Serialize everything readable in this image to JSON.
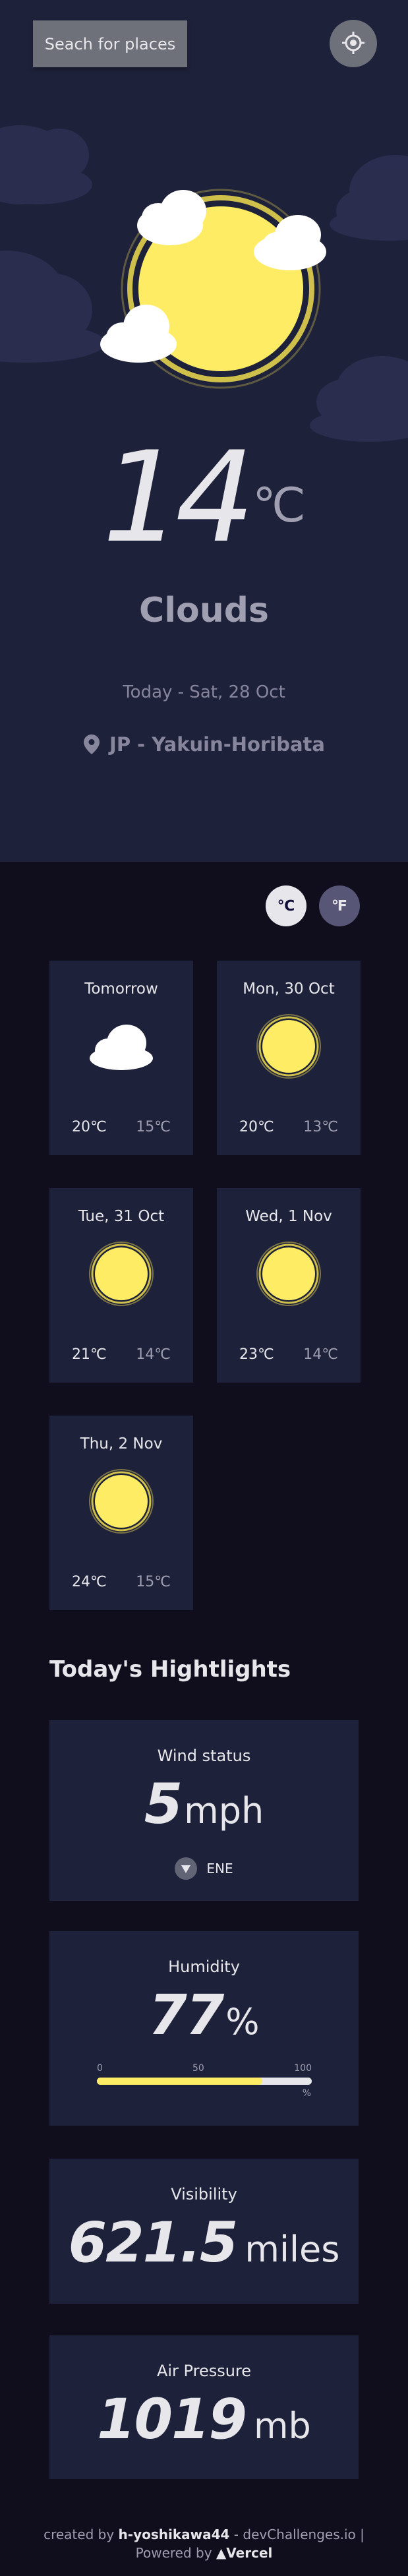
{
  "header": {
    "search_label": "Seach for places"
  },
  "current": {
    "temperature": "14",
    "unit": "℃",
    "condition": "Clouds",
    "date": "Today - Sat, 28 Oct",
    "location": "JP - Yakuin-Horibata"
  },
  "units": {
    "celsius": "℃",
    "fahrenheit": "℉",
    "selected": "celsius"
  },
  "forecast": [
    {
      "day": "Tomorrow",
      "icon": "cloud-icon",
      "max": "20℃",
      "min": "15℃"
    },
    {
      "day": "Mon, 30 Oct",
      "icon": "sun-icon",
      "max": "20℃",
      "min": "13℃"
    },
    {
      "day": "Tue, 31 Oct",
      "icon": "sun-icon",
      "max": "21℃",
      "min": "14℃"
    },
    {
      "day": "Wed, 1 Nov",
      "icon": "sun-icon",
      "max": "23℃",
      "min": "14℃"
    },
    {
      "day": "Thu, 2 Nov",
      "icon": "sun-icon",
      "max": "24℃",
      "min": "15℃"
    }
  ],
  "highlights": {
    "title": "Today's Hightlights",
    "wind": {
      "label": "Wind status",
      "value": "5",
      "unit": "mph",
      "direction": "ENE"
    },
    "humidity": {
      "label": "Humidity",
      "value": "77",
      "unit": "%",
      "percent": 77,
      "scale_0": "0",
      "scale_50": "50",
      "scale_100": "100",
      "scale_unit": "%"
    },
    "visibility": {
      "label": "Visibility",
      "value": "621.5",
      "unit": "miles"
    },
    "pressure": {
      "label": "Air Pressure",
      "value": "1019",
      "unit": "mb"
    }
  },
  "footer": {
    "prefix": "created by ",
    "author": "h-yoshikawa44",
    "middle": " - devChallenges.io |",
    "powered": "Powered by ",
    "vercel": "▲Vercel"
  },
  "colors": {
    "panel": "#1e213a",
    "background": "#100e1d",
    "sun": "#ffec65",
    "accent_gray": "#6e707a"
  }
}
